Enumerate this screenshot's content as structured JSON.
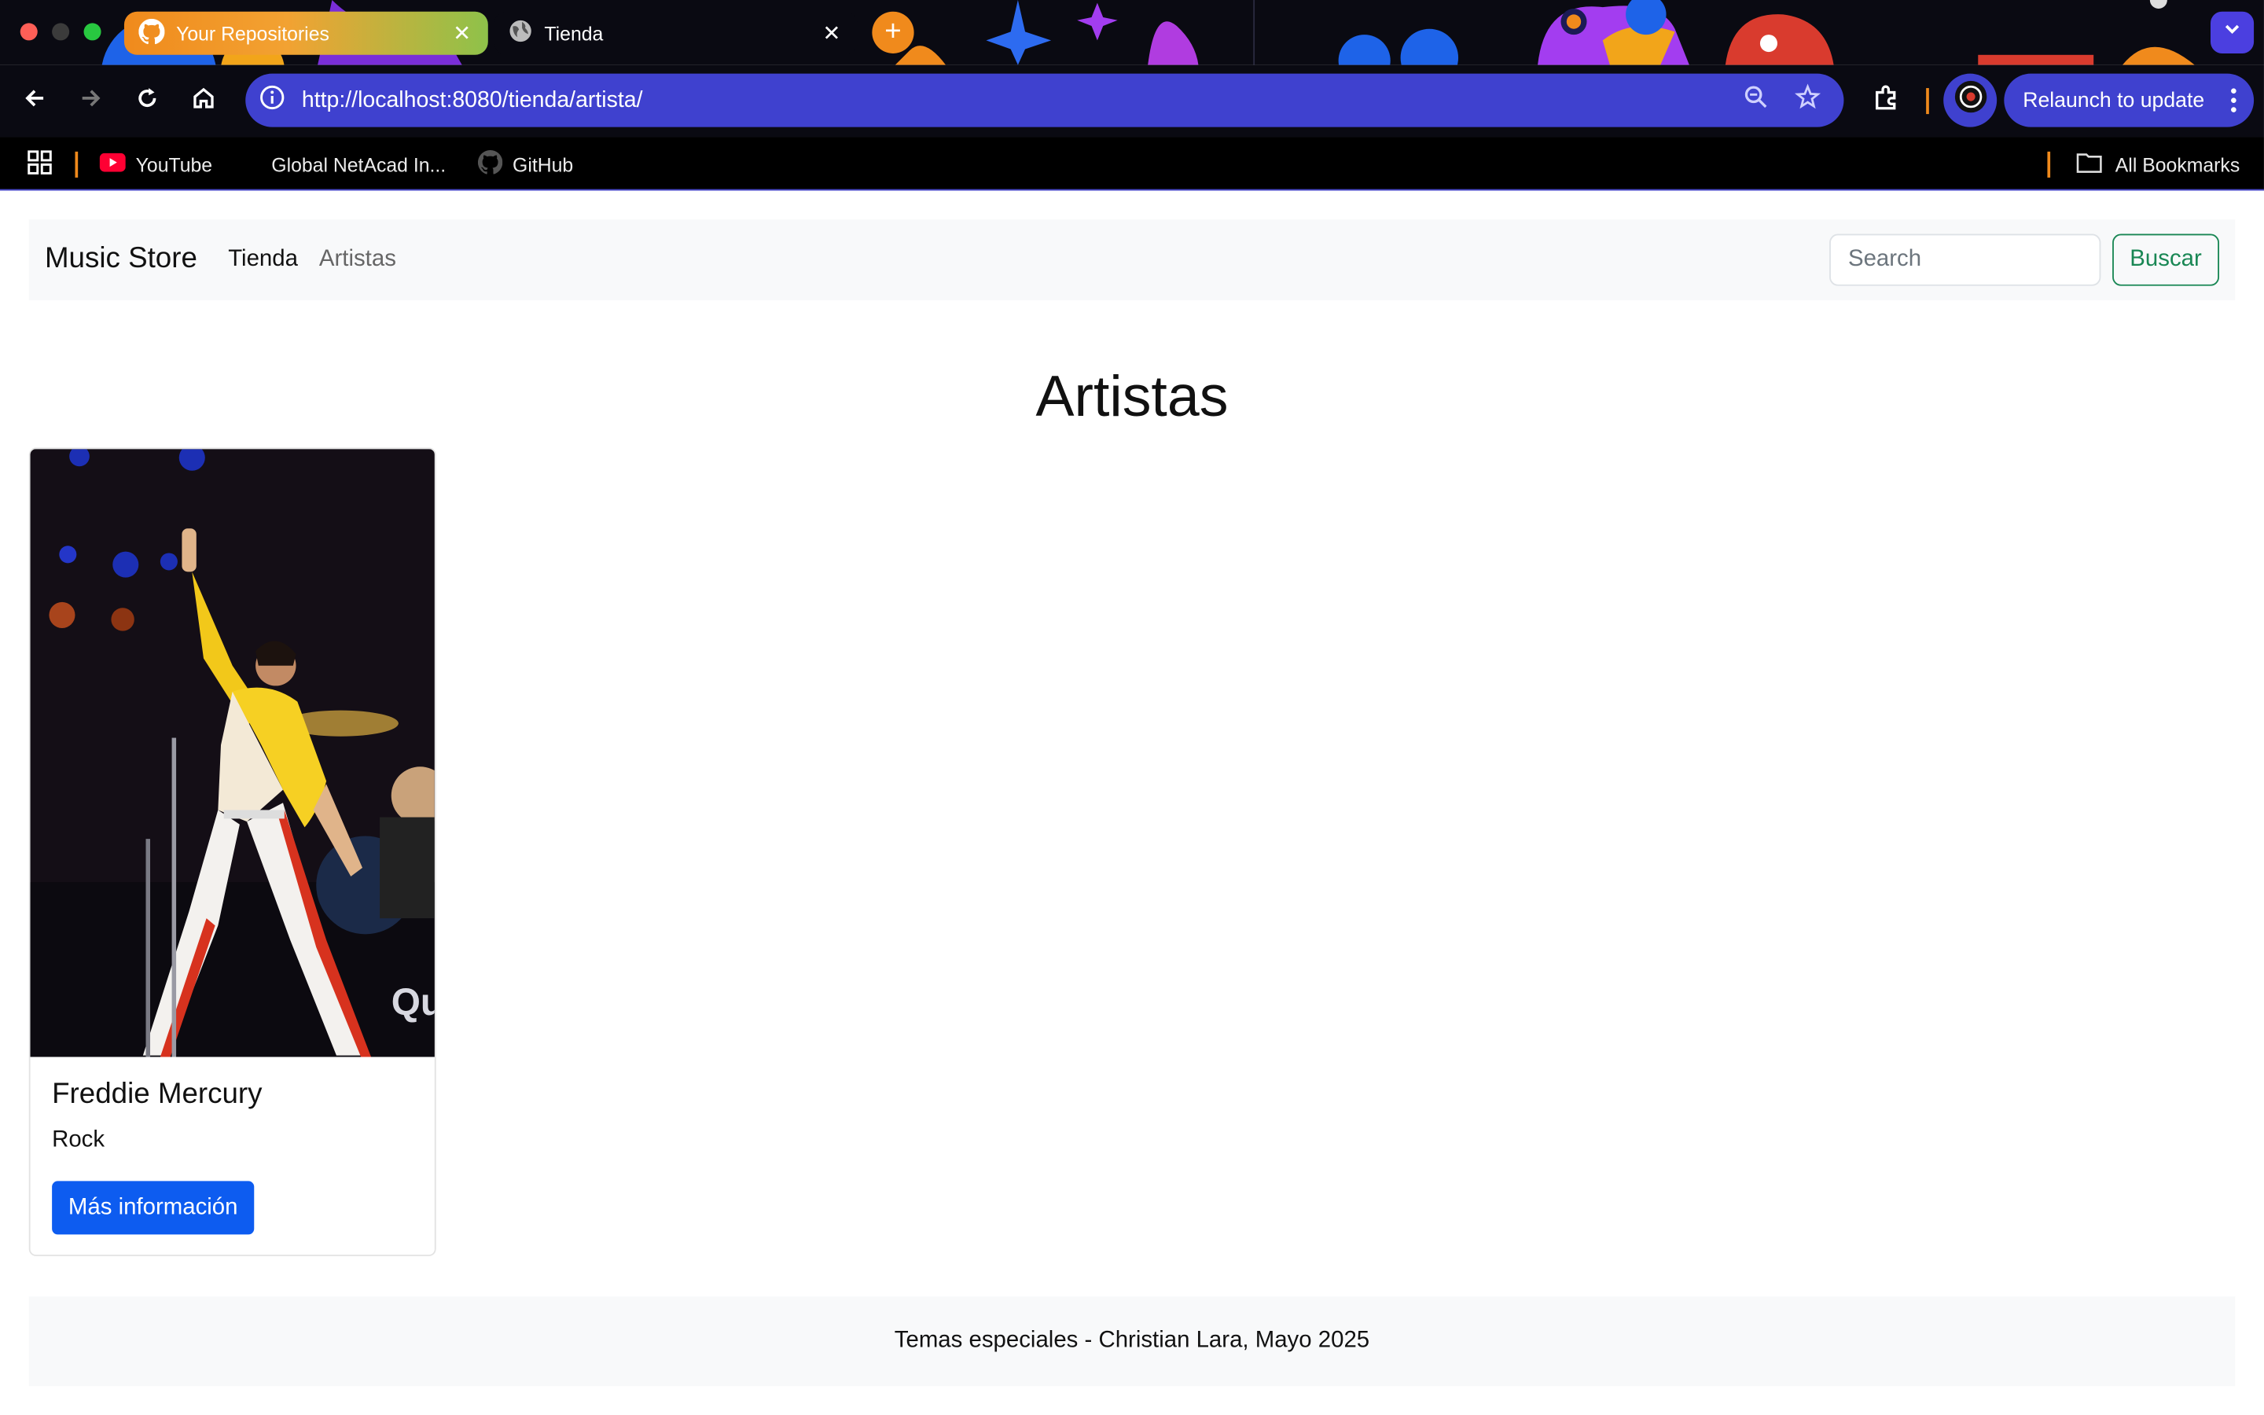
{
  "browser": {
    "tabs": [
      {
        "label": "Your Repositories",
        "icon": "github-icon",
        "color": "#ff8a1c",
        "active": false
      },
      {
        "label": "Tienda",
        "icon": "globe-icon",
        "active": true
      }
    ],
    "url": "http://localhost:8080/tienda/artista/",
    "relaunch_label": "Relaunch to update",
    "bookmarks": [
      {
        "label": "YouTube",
        "icon": "youtube-icon"
      },
      {
        "label": "Global NetAcad In...",
        "icon": "folder-icon"
      },
      {
        "label": "GitHub",
        "icon": "github-icon"
      }
    ],
    "all_bookmarks_label": "All Bookmarks"
  },
  "site": {
    "brand": "Music Store",
    "nav": [
      {
        "label": "Tienda",
        "active": true
      },
      {
        "label": "Artistas",
        "active": false
      }
    ],
    "search_placeholder": "Search",
    "search_button": "Buscar"
  },
  "main": {
    "title": "Artistas",
    "artists": [
      {
        "name": "Freddie Mercury",
        "genre": "Rock",
        "button": "Más información"
      }
    ]
  },
  "footer": {
    "text": "Temas especiales - Christian Lara, Mayo 2025"
  },
  "colors": {
    "omnibox": "#3f41cf",
    "primary_button": "#0d5cf0",
    "success_outline": "#198754",
    "navbar_bg": "#f8f9fa"
  }
}
